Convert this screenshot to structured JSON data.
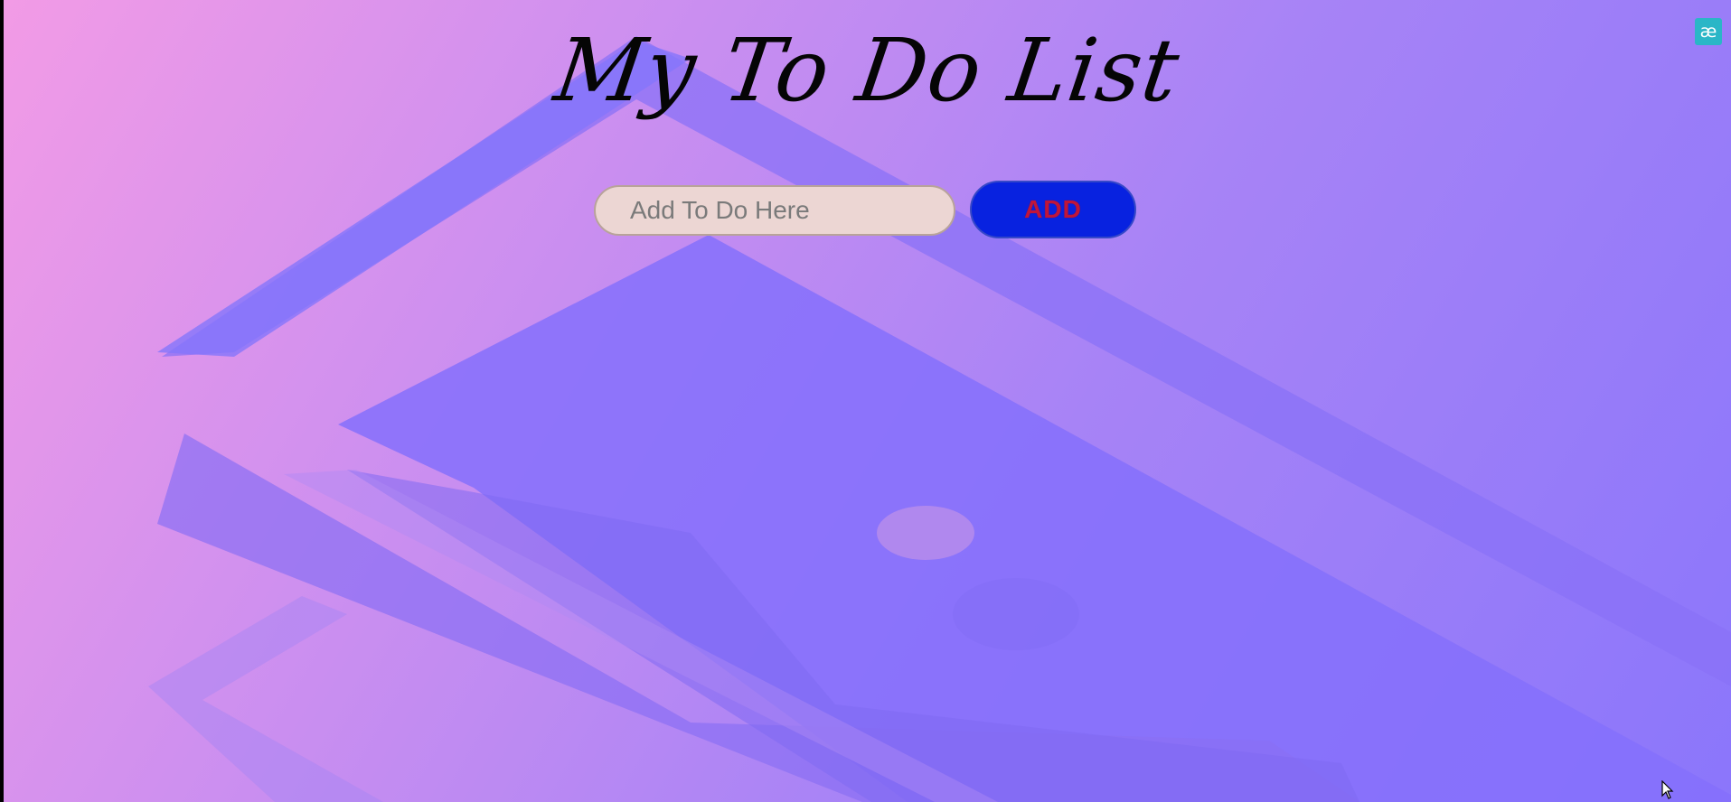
{
  "page": {
    "title": "My To Do List"
  },
  "todo_form": {
    "input_placeholder": "Add To Do Here",
    "input_value": "",
    "add_button_label": "ADD"
  },
  "extension": {
    "icon_glyph": "æ",
    "icon_name": "ae-extension-icon"
  },
  "colors": {
    "input_background": "#ecd6d3",
    "button_background": "#0822e0",
    "button_text": "#c0153a",
    "title_text": "#050505",
    "background_start": "#f29be6",
    "background_end": "#8b76fb"
  }
}
